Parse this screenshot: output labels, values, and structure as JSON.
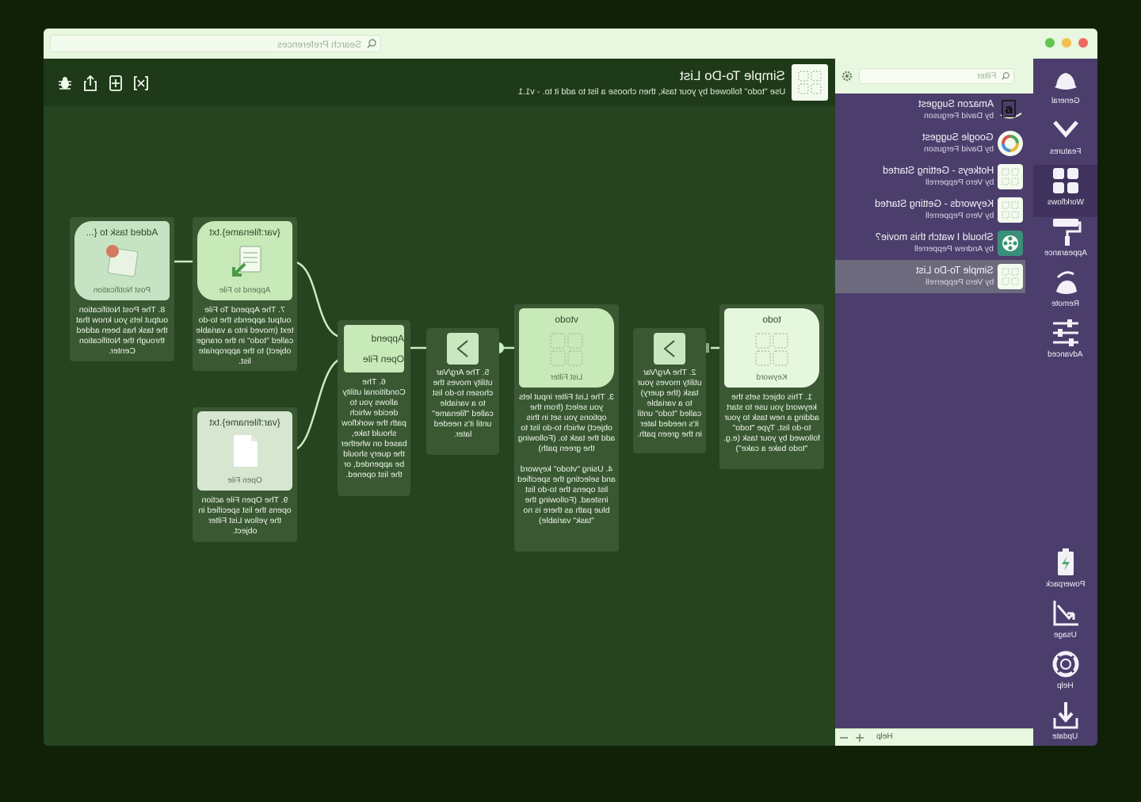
{
  "window": {
    "search_placeholder": "Search Preferences",
    "traffic_lights": [
      "#ee6b5f",
      "#f5bf4f",
      "#62c554"
    ]
  },
  "workflow": {
    "title": "Simple To-Do List",
    "description": "Use \"todo\" followed by your task, then choose a list to add it to. - v1.1",
    "toolbar_icons": [
      "bug-icon",
      "share-icon",
      "add-object-icon",
      "variables-icon"
    ]
  },
  "canvas": {
    "objects": {
      "keyword": {
        "top": "todo",
        "label": "Keyword"
      },
      "argvar1": {
        "label": "Arg/Var"
      },
      "list_filter": {
        "top": "vtodo",
        "label": "List Filter"
      },
      "argvar2": {
        "label": "Arg/Var"
      },
      "conditional": {
        "out1": "Append",
        "out2": "Open File"
      },
      "append": {
        "top": "{var:filename}.txt",
        "label": "Append to File"
      },
      "open_file": {
        "top": "{var:filename}.txt",
        "label": "Open File"
      },
      "notification": {
        "top": "Added task to {...",
        "label": "Post Notification"
      }
    },
    "notes": {
      "n1": "1. This object sets the keyword you use to start adding a new task to your to-do list. Type \"todo\" followed by your task (e.g. \"todo bake a cake\")",
      "n2": "2. The Arg/Var utility moves your task (the query) to a variable called \"todo\" until it's needed later in the green path.",
      "n3": "3. The List Filter input lets you select (from the options you set in this object) which to-do list to add the task to. (Following the green path)\n\n4. Using \"vtodo\" keyword and selecting the specified list opens the to-do list instead. (Following the blue path as there is no \"task\" variable)",
      "n5": "5. The Arg/Var utility moves the chosen to-do list to a variable called \"filename\" until it's needed later.",
      "n6": "6. The Conditional utility allows you to decide which path the workflow should take, based on whether the query should be appended, or the list opened.",
      "n7": "7. The Append To File output appends the to-do text (moved into a variable called \"todo\" in the orange object) to the appropriate list.",
      "n8": "8. The Post Notification output lets you know that the task has been added through the Notification Center.",
      "n9": "9. The Open File action opens the list specified in the yellow List Filter object."
    }
  },
  "sidebar": {
    "filter_placeholder": "Filter",
    "workflows": [
      {
        "name": "Amazon Suggest",
        "author": "by David Ferguson",
        "icon": "amazon-icon"
      },
      {
        "name": "Google Suggest",
        "author": "by David Ferguson",
        "icon": "google-icon"
      },
      {
        "name": "Hotkeys - Getting Started",
        "author": "by Vero Pepperrell",
        "icon": "workflow-grid-icon"
      },
      {
        "name": "Keywords - Getting Started",
        "author": "by Vero Pepperrell",
        "icon": "workflow-grid-icon"
      },
      {
        "name": "Should I watch this movie?",
        "author": "by Andrew Pepperrell",
        "icon": "film-reel-icon"
      },
      {
        "name": "Simple To-Do List",
        "author": "by Vero Pepperrell",
        "icon": "workflow-grid-icon"
      }
    ],
    "bottom": {
      "help": "Help"
    }
  },
  "nav": {
    "items": [
      "General",
      "Features",
      "Workflows",
      "Appearance",
      "Remote",
      "Advanced"
    ],
    "bottom_items": [
      "Powerpack",
      "Usage",
      "Help",
      "Update"
    ],
    "selected": "Workflows"
  }
}
